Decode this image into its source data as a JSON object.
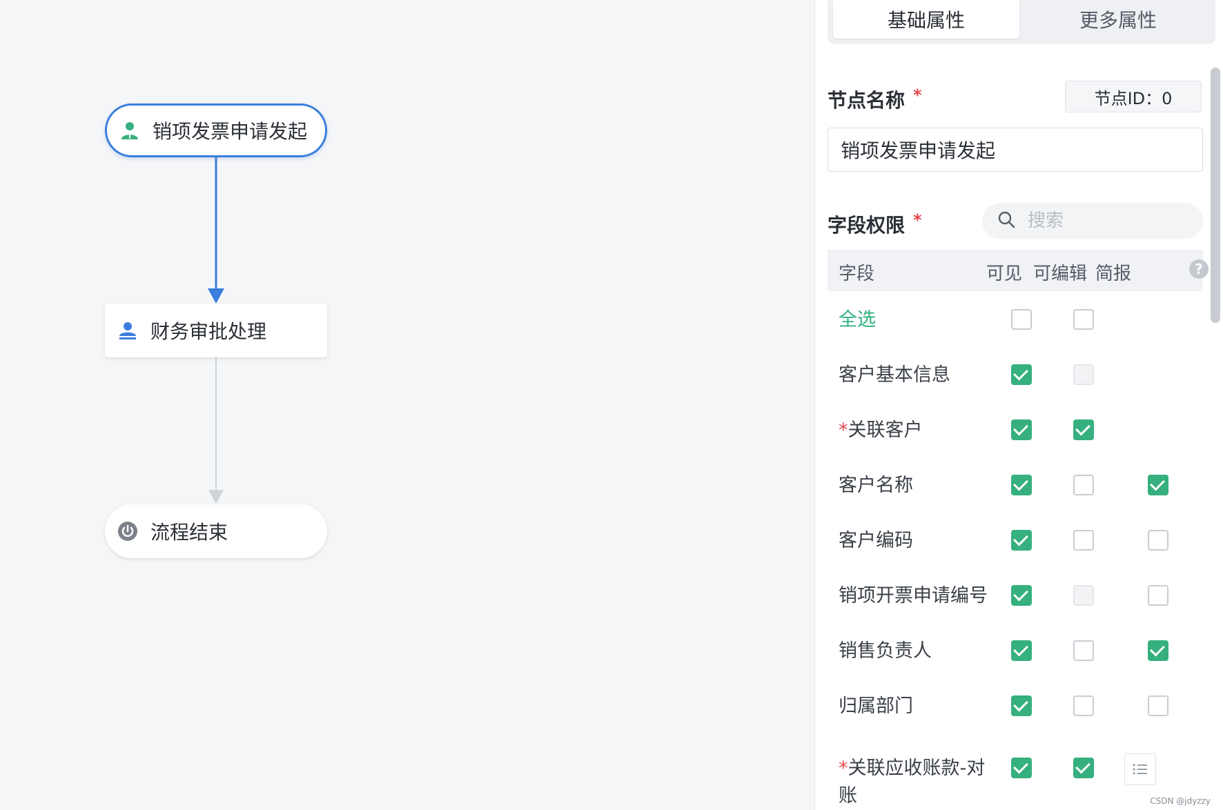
{
  "flow": {
    "nodes": [
      {
        "label": "销项发票申请发起",
        "icon": "initiator-person-icon"
      },
      {
        "label": "财务审批处理",
        "icon": "approver-person-icon"
      },
      {
        "label": "流程结束",
        "icon": "power-icon"
      }
    ]
  },
  "panel": {
    "tabs": [
      "基础属性",
      "更多属性"
    ],
    "active_tab": "基础属性",
    "node_name_label": "节点名称",
    "node_id": "节点ID：0",
    "node_name_value": "销项发票申请发起",
    "field_perm_label": "字段权限",
    "search_placeholder": "搜索",
    "required_mark": "*",
    "columns": [
      "字段",
      "可见",
      "可编辑",
      "简报"
    ],
    "select_all": "全选",
    "fields": [
      {
        "name": "客户基本信息",
        "visible": "on",
        "editable": "dis",
        "brief": "none"
      },
      {
        "name": "关联客户",
        "required": true,
        "visible": "on",
        "editable": "on",
        "brief": "none"
      },
      {
        "name": "客户名称",
        "visible": "on",
        "editable": "off",
        "brief": "on"
      },
      {
        "name": "客户编码",
        "visible": "on",
        "editable": "off",
        "brief": "off"
      },
      {
        "name": "销项开票申请编号",
        "visible": "on",
        "editable": "dis",
        "brief": "off"
      },
      {
        "name": "销售负责人",
        "visible": "on",
        "editable": "off",
        "brief": "on"
      },
      {
        "name": "归属部门",
        "visible": "on",
        "editable": "off",
        "brief": "off"
      },
      {
        "name": "关联应收账款-对账",
        "required": true,
        "visible": "on",
        "editable": "on",
        "brief": "list"
      }
    ]
  },
  "colors": {
    "accent_blue": "#3b7ddd",
    "check_green": "#36b07e",
    "required_red": "#e5484d"
  },
  "watermark": "CSDN @jdyzzy"
}
